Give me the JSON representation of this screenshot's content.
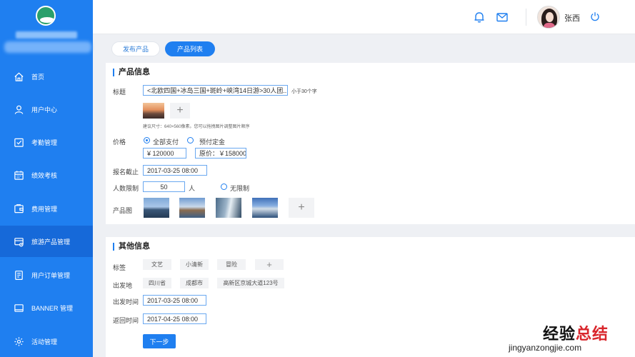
{
  "sidebar": {
    "items": [
      {
        "label": "首页",
        "icon": "home-icon"
      },
      {
        "label": "用户中心",
        "icon": "user-icon"
      },
      {
        "label": "考勤管理",
        "icon": "checkbox-icon"
      },
      {
        "label": "绩效考核",
        "icon": "calendar-icon"
      },
      {
        "label": "费用管理",
        "icon": "wallet-icon"
      },
      {
        "label": "旅游产品管理",
        "icon": "product-card-icon",
        "active": true
      },
      {
        "label": "用户订单管理",
        "icon": "document-icon"
      },
      {
        "label": "BANNER 管理",
        "icon": "banner-icon"
      },
      {
        "label": "活动管理",
        "icon": "gear-icon"
      }
    ],
    "accent": "#1f7ff0"
  },
  "header": {
    "username": "张西",
    "icons": [
      "bell-icon",
      "mail-icon",
      "power-icon"
    ]
  },
  "tabs": [
    {
      "label": "发布产品",
      "active": false
    },
    {
      "label": "产品列表",
      "active": true
    }
  ],
  "product_info": {
    "section_title": "产品信息",
    "title_label": "标题",
    "title_value": "<北欧四国+冰岛三国+斑岭+峡湾14日游>30人团...",
    "title_hint": "小于30个字",
    "image_hint": "建议尺寸：640×560像素。您可以拖拽图片调整图片顺序",
    "price_label": "价格",
    "price_options": [
      "全部支付",
      "预付定金"
    ],
    "price_value": "¥    120000",
    "original_price": "原价：￥158000",
    "deadline_label": "报名截止",
    "deadline_value": "2017-03-25  08:00",
    "people_label": "人数限制",
    "people_value": "50",
    "people_unit": "人",
    "unlimited_label": "无限制",
    "product_images_label": "产品图"
  },
  "other_info": {
    "section_title": "其他信息",
    "tags_label": "标签",
    "tags": [
      "文艺",
      "小清新",
      "冒险"
    ],
    "departure_label": "出发地",
    "departure": [
      "四川省",
      "成都市",
      "高新区京城大道123号"
    ],
    "depart_time_label": "出发时间",
    "depart_time": "2017-03-25 08:00",
    "return_time_label": "返回时间",
    "return_time": "2017-04-25 08:00",
    "next_button": "下一步"
  },
  "watermark": {
    "line1_a": "经验",
    "line1_b": "总结",
    "line2": "jingyanzongjie.com"
  }
}
